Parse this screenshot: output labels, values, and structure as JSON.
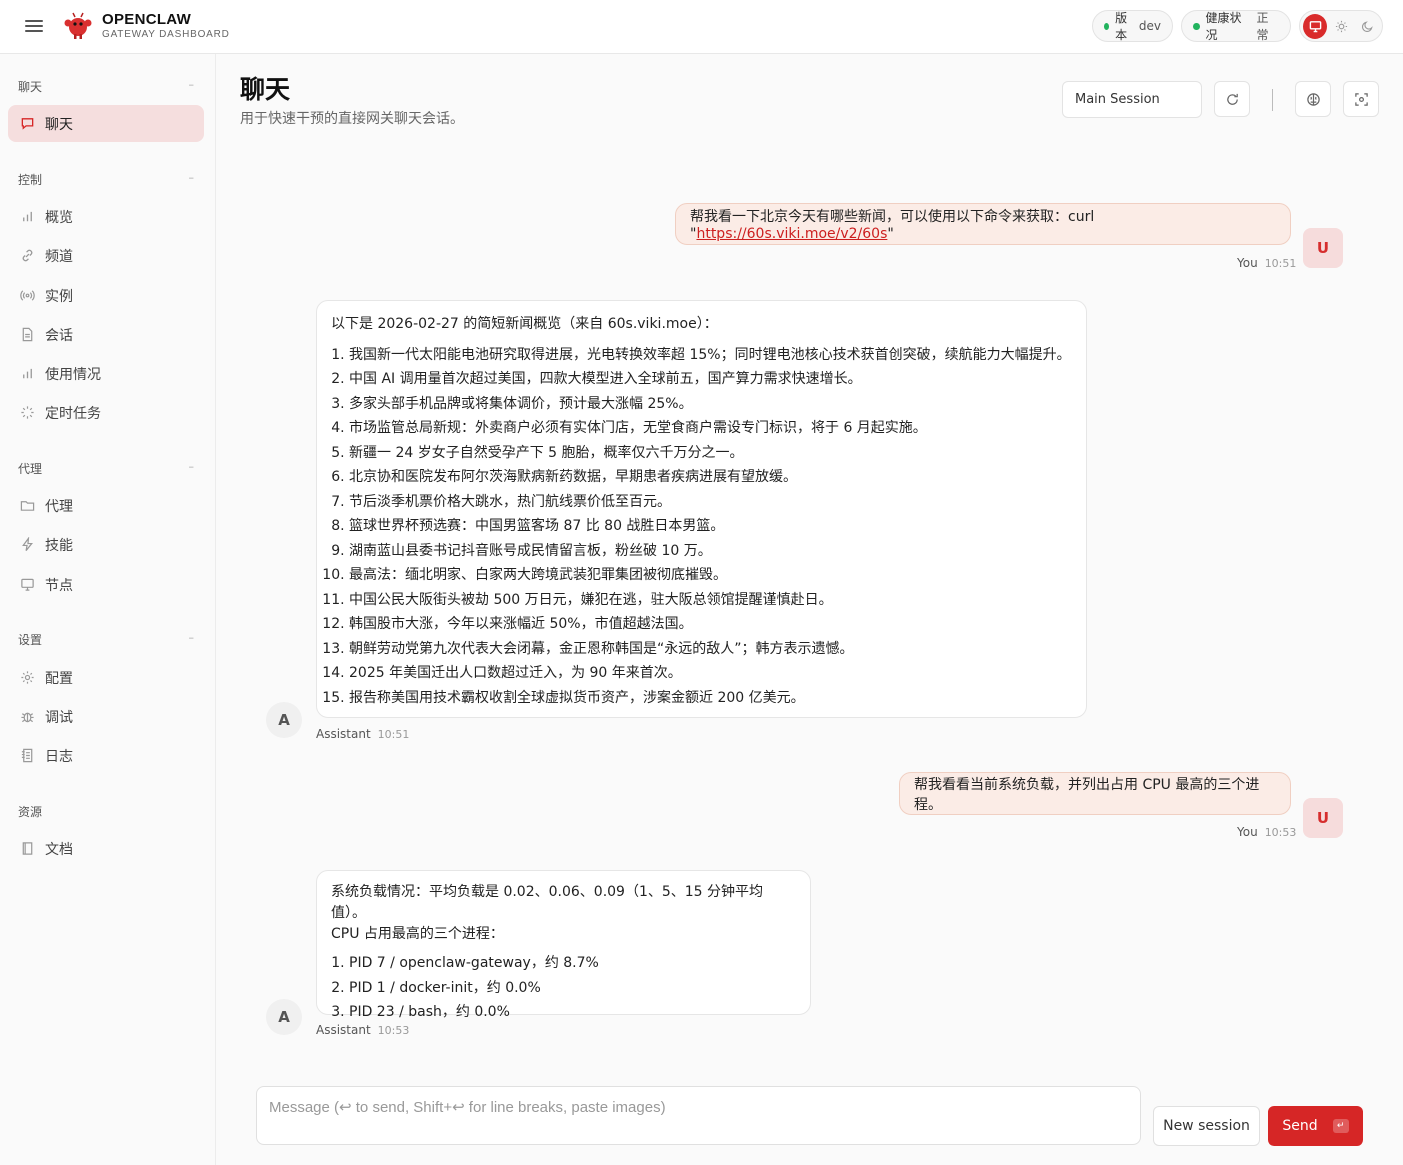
{
  "brand": {
    "name": "OPENCLAW",
    "subtitle": "GATEWAY DASHBOARD"
  },
  "status": {
    "version_label": "版本",
    "version_value": "dev",
    "health_label": "健康状况",
    "health_value": "正常",
    "status_color": "#22b35e"
  },
  "sidebar": {
    "sections": [
      {
        "title": "聊天",
        "items": [
          {
            "label": "聊天",
            "icon": "chat-icon",
            "active": true
          }
        ]
      },
      {
        "title": "控制",
        "items": [
          {
            "label": "概览",
            "icon": "bar-chart-icon"
          },
          {
            "label": "频道",
            "icon": "link-icon"
          },
          {
            "label": "实例",
            "icon": "broadcast-icon"
          },
          {
            "label": "会话",
            "icon": "document-icon"
          },
          {
            "label": "使用情况",
            "icon": "bar-chart-icon"
          },
          {
            "label": "定时任务",
            "icon": "loader-icon"
          }
        ]
      },
      {
        "title": "代理",
        "items": [
          {
            "label": "代理",
            "icon": "folder-icon"
          },
          {
            "label": "技能",
            "icon": "lightning-icon"
          },
          {
            "label": "节点",
            "icon": "monitor-icon"
          }
        ]
      },
      {
        "title": "设置",
        "items": [
          {
            "label": "配置",
            "icon": "gear-icon"
          },
          {
            "label": "调试",
            "icon": "bug-icon"
          },
          {
            "label": "日志",
            "icon": "log-icon"
          }
        ]
      },
      {
        "title": "资源",
        "items": [
          {
            "label": "文档",
            "icon": "book-icon"
          }
        ]
      }
    ]
  },
  "page": {
    "title": "聊天",
    "subtitle": "用于快速干预的直接网关聊天会话。",
    "session": "Main Session"
  },
  "messages": [
    {
      "role": "user",
      "sender": "You",
      "time": "10:51",
      "avatar": "U",
      "text_before": "帮我看一下北京今天有哪些新闻，可以使用以下命令来获取：curl \"",
      "link": "https://60s.viki.moe/v2/60s",
      "text_after": "\""
    },
    {
      "role": "assistant",
      "sender": "Assistant",
      "time": "10:51",
      "avatar": "A",
      "intro": "以下是 2026-02-27 的简短新闻概览（来自 60s.viki.moe）：",
      "items": [
        "我国新一代太阳能电池研究取得进展，光电转换效率超 15%；同时锂电池核心技术获首创突破，续航能力大幅提升。",
        "中国 AI 调用量首次超过美国，四款大模型进入全球前五，国产算力需求快速增长。",
        "多家头部手机品牌或将集体调价，预计最大涨幅 25%。",
        "市场监管总局新规：外卖商户必须有实体门店，无堂食商户需设专门标识，将于 6 月起实施。",
        "新疆一 24 岁女子自然受孕产下 5 胞胎，概率仅六千万分之一。",
        "北京协和医院发布阿尔茨海默病新药数据，早期患者疾病进展有望放缓。",
        "节后淡季机票价格大跳水，热门航线票价低至百元。",
        "篮球世界杯预选赛：中国男篮客场 87 比 80 战胜日本男篮。",
        "湖南蓝山县委书记抖音账号成民情留言板，粉丝破 10 万。",
        "最高法：缅北明家、白家两大跨境武装犯罪集团被彻底摧毁。",
        "中国公民大阪街头被劫 500 万日元，嫌犯在逃，驻大阪总领馆提醒谨慎赴日。",
        "韩国股市大涨，今年以来涨幅近 50%，市值超越法国。",
        "朝鲜劳动党第九次代表大会闭幕，金正恩称韩国是“永远的敌人”；韩方表示遗憾。",
        "2025 年美国迁出人口数超过迁入，为 90 年来首次。",
        "报告称美国用技术霸权收割全球虚拟货币资产，涉案金额近 200 亿美元。"
      ]
    },
    {
      "role": "user",
      "sender": "You",
      "time": "10:53",
      "avatar": "U",
      "text": "帮我看看当前系统负载，并列出占用 CPU 最高的三个进程。"
    },
    {
      "role": "assistant",
      "sender": "Assistant",
      "time": "10:53",
      "avatar": "A",
      "intro": "系统负载情况：平均负载是 0.02、0.06、0.09（1、5、15 分钟平均值）。",
      "intro2": "CPU 占用最高的三个进程：",
      "items": [
        "PID 7 / openclaw-gateway，约 8.7%",
        "PID 1 / docker-init，约 0.0%",
        "PID 23 / bash，约 0.0%"
      ]
    }
  ],
  "composer": {
    "placeholder": "Message (↩ to send, Shift+↩ for line breaks, paste images)",
    "new_session": "New session",
    "send": "Send",
    "send_hint": "↵"
  },
  "colors": {
    "accent": "#d62626",
    "user_bubble": "#fbece6",
    "active_nav": "#f5dede"
  }
}
